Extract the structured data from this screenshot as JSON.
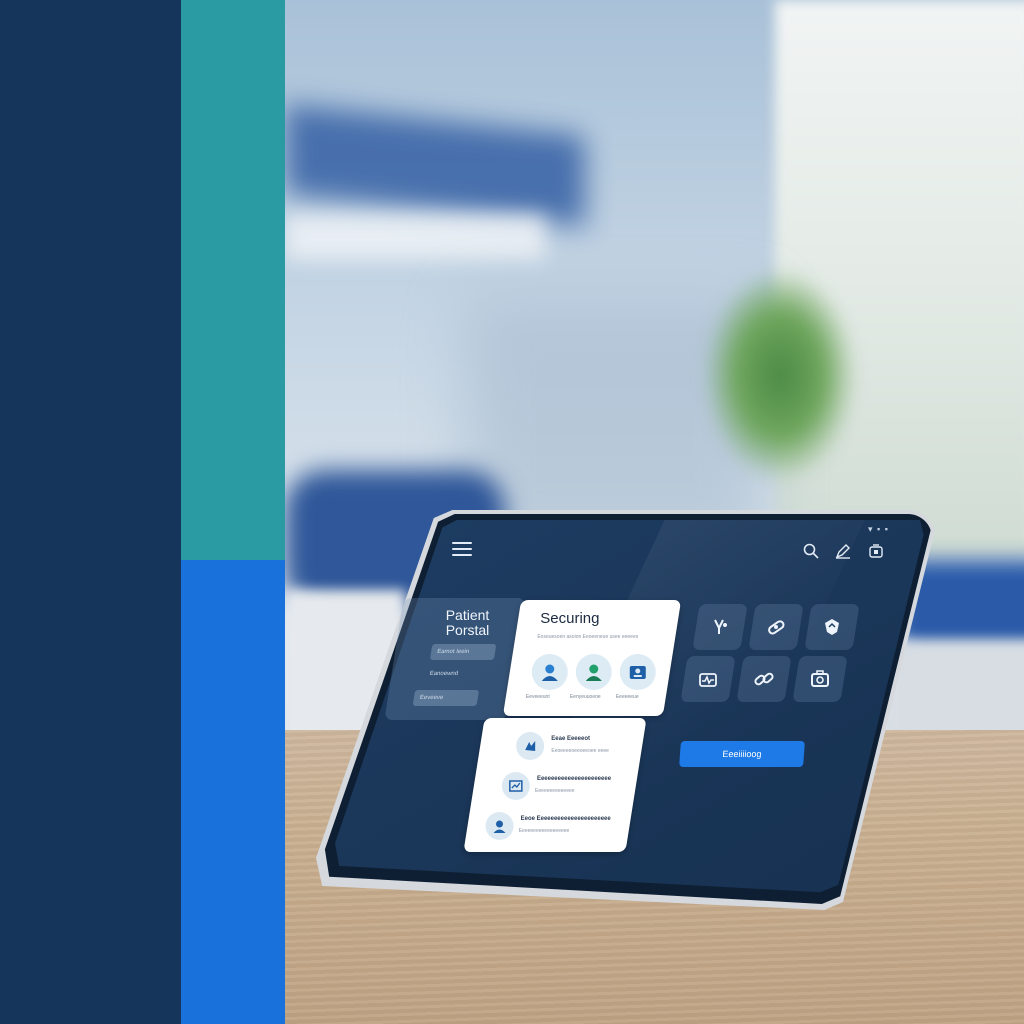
{
  "portal": {
    "title_line1": "Patient",
    "title_line2": "Porstal",
    "menu_items": [
      "Eamot Ieein",
      "Eanoewnd",
      "Eeveeve"
    ]
  },
  "securing_card": {
    "title": "Securing",
    "subtitle": "Eoseuesoen asoion Eeoeeneue usee eeeees",
    "avatars": [
      {
        "icon": "user-icon",
        "caption": "Eeveeeunt"
      },
      {
        "icon": "doctor-icon",
        "caption": "Eenyeuuoeoe"
      },
      {
        "icon": "id-card-icon",
        "caption": "Eeeeeeue"
      }
    ]
  },
  "list_card": {
    "rows": [
      {
        "icon": "document-icon",
        "title": "Eeae Eeeeeot",
        "sub": "Eeoeeeeoeeoeeoee eeee"
      },
      {
        "icon": "chart-icon",
        "title": "Eeeeeeeeeeeeeeeeeeeeee",
        "sub": "Eeeeeeeeeeeeee"
      },
      {
        "icon": "profile-icon",
        "title": "Eeoe Eeeeeeeeeeeeeeeeeeeeee",
        "sub": "Eeeeeeeeeeeeeeeeee"
      }
    ]
  },
  "tiles": [
    {
      "icon": "stethoscope-icon"
    },
    {
      "icon": "pill-icon"
    },
    {
      "icon": "shield-icon"
    },
    {
      "icon": "heart-monitor-icon"
    },
    {
      "icon": "link-icon"
    },
    {
      "icon": "medical-kit-icon"
    }
  ],
  "cta": {
    "label": "Eeeiiiioog"
  },
  "colors": {
    "band_navy": "#15365a",
    "band_teal": "#2a9aa3",
    "band_blue": "#1972dc",
    "screen_bg": "#1e3d63",
    "accent": "#1e7ae6"
  }
}
